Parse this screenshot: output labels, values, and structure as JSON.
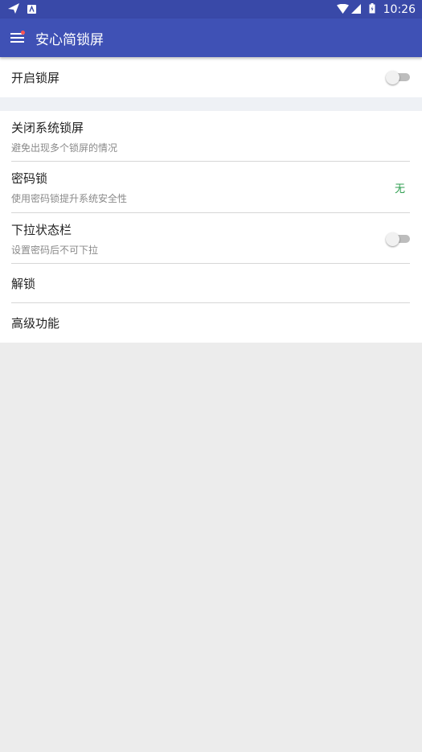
{
  "status_bar": {
    "time": "10:26",
    "icons": [
      "send-icon",
      "notification-a-icon",
      "wifi-icon",
      "signal-icon",
      "battery-icon"
    ]
  },
  "toolbar": {
    "title": "安心简锁屏",
    "menu_icon": "hamburger-menu-icon",
    "badge_color": "#ff5252"
  },
  "settings": {
    "enable_lock": {
      "title": "开启锁屏",
      "toggle_on": false
    },
    "close_system_lock": {
      "title": "关闭系统锁屏",
      "subtitle": "避免出现多个锁屏的情况"
    },
    "password_lock": {
      "title": "密码锁",
      "subtitle": "使用密码锁提升系统安全性",
      "value": "无"
    },
    "pulldown_status_bar": {
      "title": "下拉状态栏",
      "subtitle": "设置密码后不可下拉",
      "toggle_on": false
    },
    "unlock": {
      "title": "解锁"
    },
    "advanced": {
      "title": "高级功能"
    }
  },
  "colors": {
    "primary": "#3f51b5",
    "primary_dark": "#3949a8",
    "value_green": "#2e9e4f",
    "background": "#ececec"
  }
}
